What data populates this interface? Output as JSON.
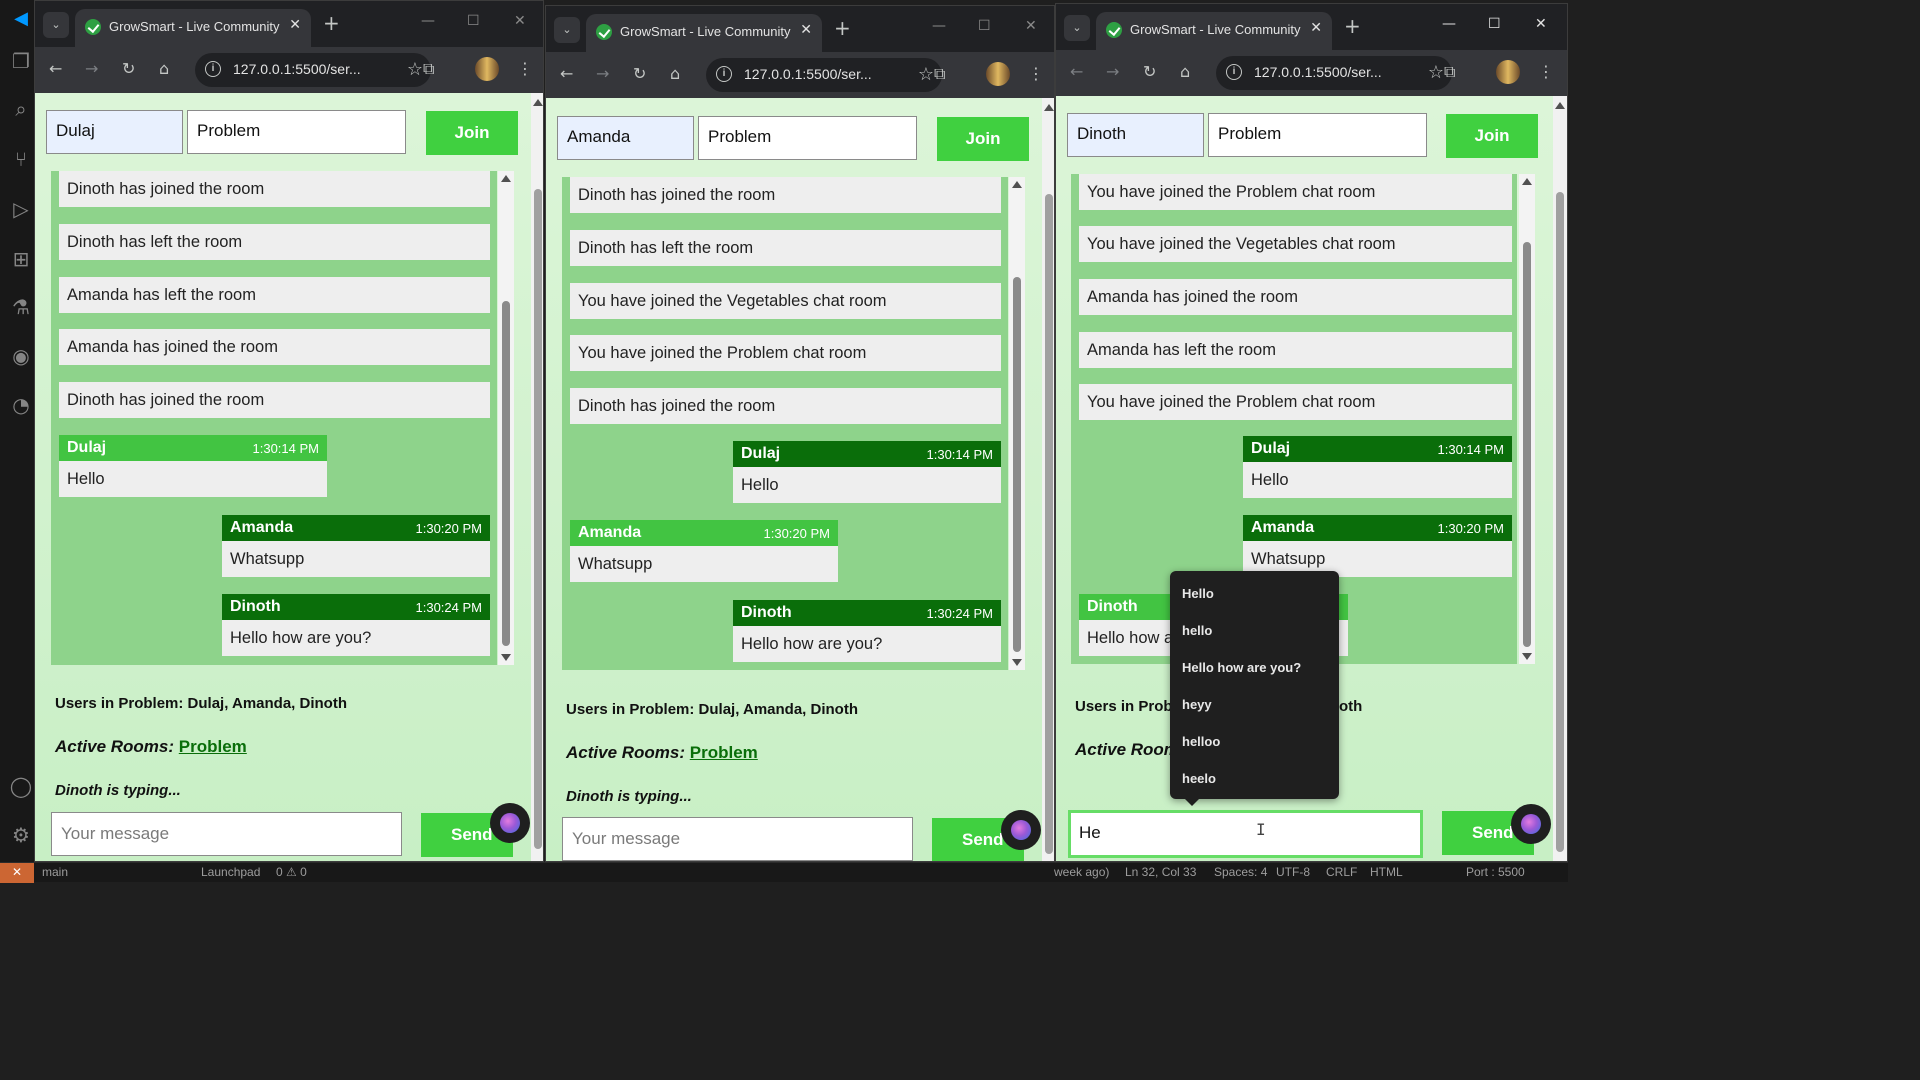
{
  "status": {
    "branch": "main",
    "launchpad": "Launchpad",
    "problems": "0 ⚠ 0",
    "ago": "week ago)",
    "cursor_pos": "Ln 32, Col 33",
    "spaces": "Spaces: 4",
    "encoding": "UTF-8",
    "eol": "CRLF",
    "lang": "HTML",
    "port": "Port : 5500"
  },
  "windows": [
    {
      "tab_title": "GrowSmart - Live Community C",
      "url": "127.0.0.1:5500/ser...",
      "username": "Dulaj",
      "room": "Problem",
      "join_label": "Join",
      "system_messages": [
        "Dinoth has joined the room",
        "Dinoth has left the room",
        "Amanda has left the room",
        "Amanda has joined the room",
        "Dinoth has joined the room"
      ],
      "messages": [
        {
          "name": "Dulaj",
          "time": "1:30:14 PM",
          "text": "Hello"
        },
        {
          "name": "Amanda",
          "time": "1:30:20 PM",
          "text": "Whatsupp"
        },
        {
          "name": "Dinoth",
          "time": "1:30:24 PM",
          "text": "Hello how are you?"
        }
      ],
      "users_line": "Users in Problem: Dulaj, Amanda, Dinoth",
      "active_rooms_label": "Active Rooms:",
      "active_room": "Problem",
      "typing": "Dinoth is typing...",
      "message_placeholder": "Your message",
      "send_label": "Send"
    },
    {
      "tab_title": "GrowSmart - Live Community C",
      "url": "127.0.0.1:5500/ser...",
      "username": "Amanda",
      "room": "Problem",
      "join_label": "Join",
      "system_messages": [
        "Dinoth has joined the room",
        "Dinoth has left the room",
        "You have joined the Vegetables chat room",
        "You have joined the Problem chat room",
        "Dinoth has joined the room"
      ],
      "messages": [
        {
          "name": "Dulaj",
          "time": "1:30:14 PM",
          "text": "Hello"
        },
        {
          "name": "Amanda",
          "time": "1:30:20 PM",
          "text": "Whatsupp"
        },
        {
          "name": "Dinoth",
          "time": "1:30:24 PM",
          "text": "Hello how are you?"
        }
      ],
      "users_line": "Users in Problem: Dulaj, Amanda, Dinoth",
      "active_rooms_label": "Active Rooms:",
      "active_room": "Problem",
      "typing": "Dinoth is typing...",
      "message_placeholder": "Your message",
      "send_label": "Send"
    },
    {
      "tab_title": "GrowSmart - Live Community C",
      "url": "127.0.0.1:5500/ser...",
      "username": "Dinoth",
      "room": "Problem",
      "join_label": "Join",
      "system_messages": [
        "You have joined the Problem chat room",
        "You have joined the Vegetables chat room",
        "Amanda has joined the room",
        "Amanda has left the room",
        "You have joined the Problem chat room"
      ],
      "messages": [
        {
          "name": "Dulaj",
          "time": "1:30:14 PM",
          "text": "Hello"
        },
        {
          "name": "Amanda",
          "time": "1:30:20 PM",
          "text": "Whatsupp"
        },
        {
          "name": "Dinoth",
          "time": "",
          "text": "Hello how a"
        }
      ],
      "users_line_start": "Users in Prob",
      "users_line_end": "oth",
      "active_rooms_label": "Active Room",
      "message_value": "He",
      "send_label": "Send",
      "autocomplete": [
        "Hello",
        "hello",
        "Hello how are you?",
        "heyy",
        "helloo",
        "heelo"
      ]
    }
  ]
}
